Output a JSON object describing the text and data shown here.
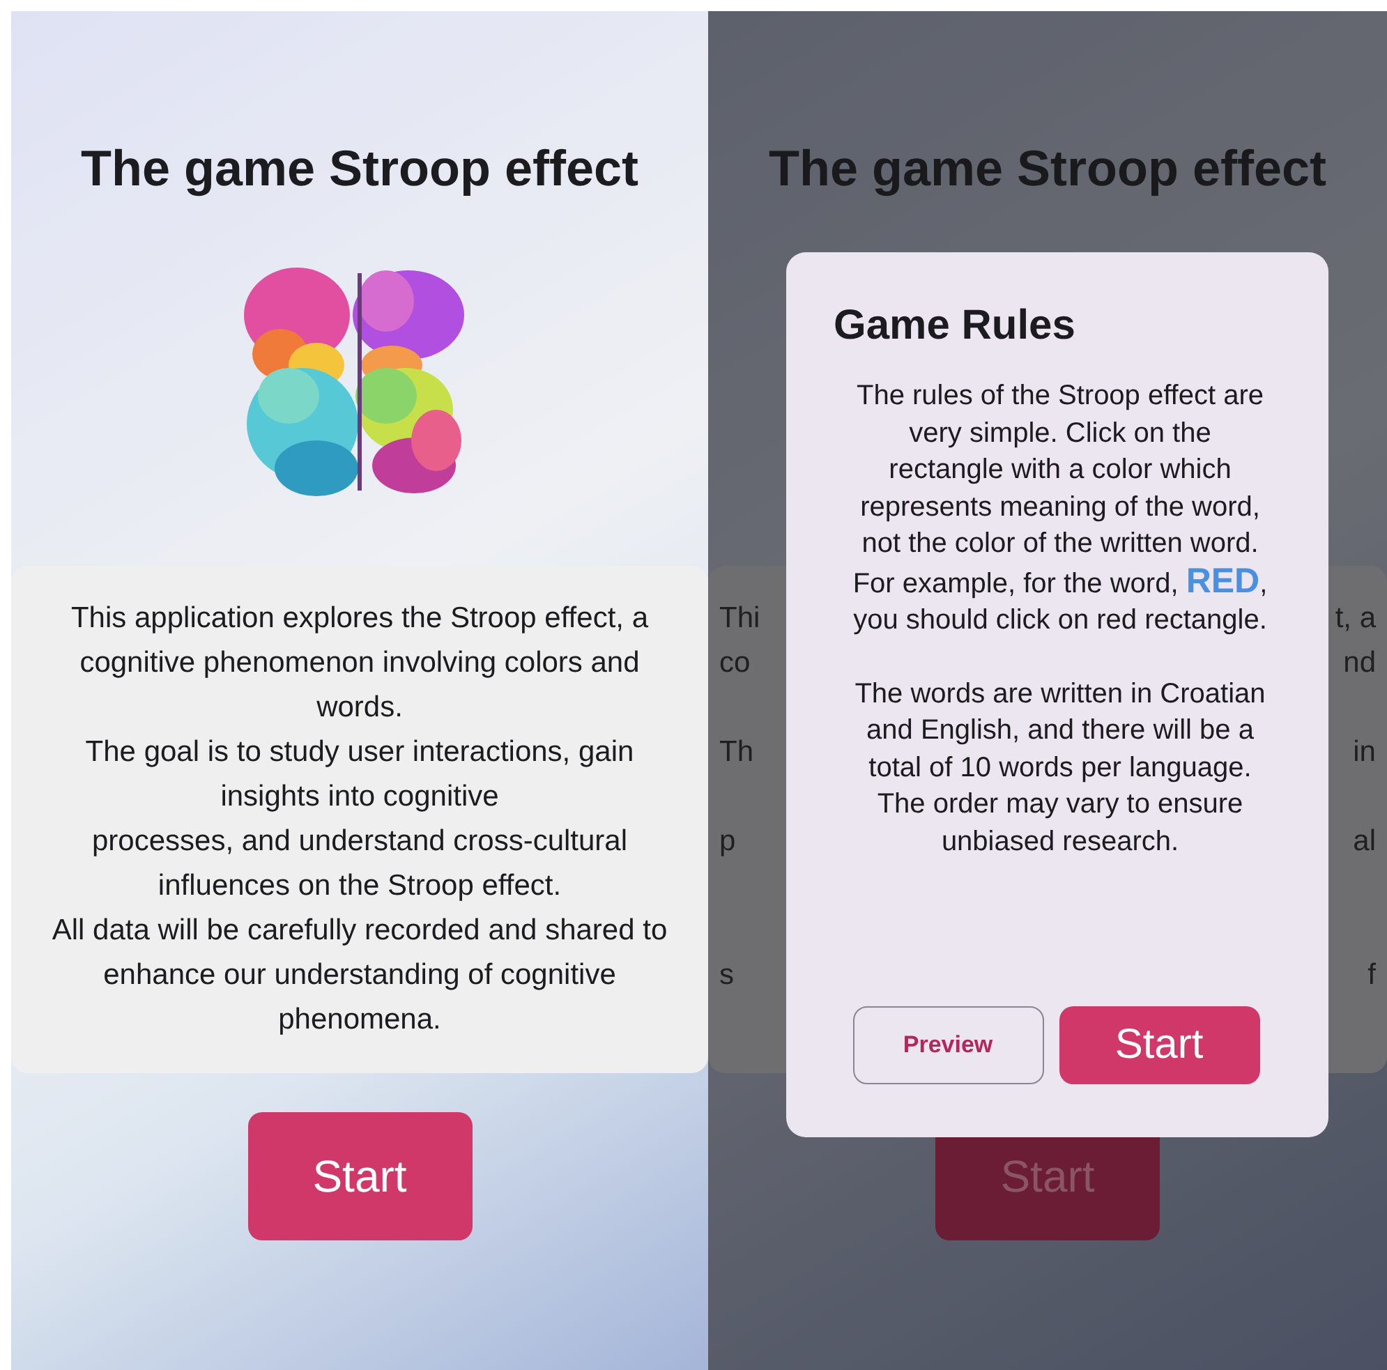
{
  "main_screen": {
    "title": "The game Stroop effect",
    "paragraphs": [
      "This application explores the Stroop effect, a cognitive phenomenon involving colors and words.",
      "The goal is to study user interactions, gain insights into cognitive",
      "processes, and understand cross-cultural influences on the Stroop effect.",
      "All data will be carefully recorded and shared to enhance our understanding of cognitive phenomena."
    ],
    "start_button": "Start"
  },
  "dimmed_screen": {
    "title": "The game Stroop effect",
    "fragment_rows": [
      {
        "left": "Thi",
        "right": "t, a"
      },
      {
        "left": "co",
        "right": "nd"
      },
      {},
      {
        "left": "Th",
        "right": "in"
      },
      {},
      {
        "left": "p",
        "right": "al"
      },
      {},
      {},
      {
        "left": "s",
        "right": "f"
      },
      {}
    ],
    "start_button": "Start"
  },
  "rules_dialog": {
    "title": "Game Rules",
    "paragraphs": [
      "The rules of the Stroop effect are very simple. Click on the rectangle with a color which represents meaning of the word, not the color of the written word.",
      "For example, for the word, **RED**, you should click on red rectangle.",
      "The words are written in Croatian and English, and there will be a total of 10 words per language.",
      "The order may vary to ensure unbiased research."
    ],
    "buttons": [
      {
        "label": "Preview",
        "kind": "outlined"
      },
      {
        "label": "Start",
        "kind": "filled"
      }
    ]
  }
}
